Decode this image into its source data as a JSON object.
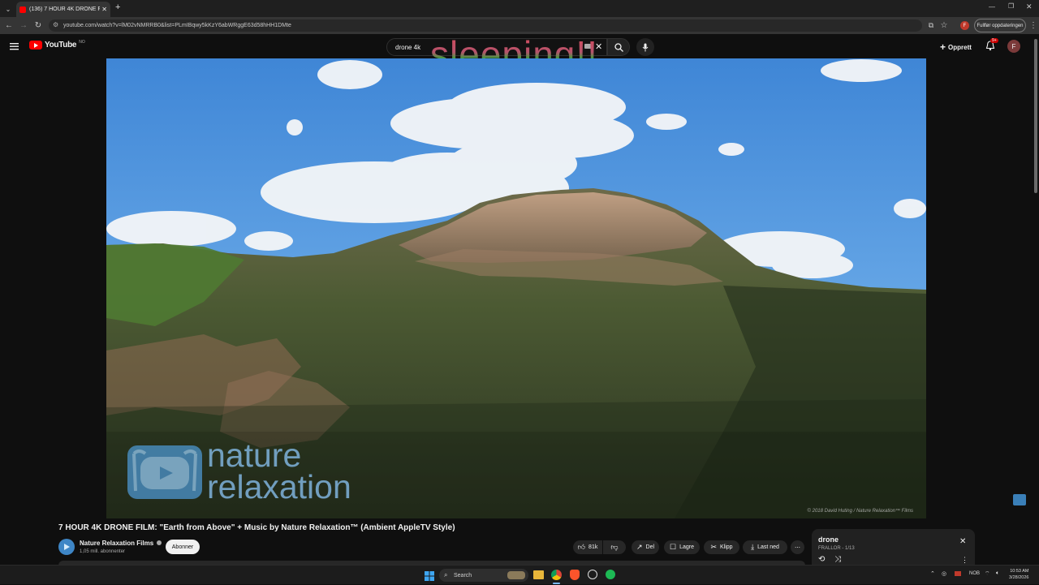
{
  "browser": {
    "tab_title": "(136) 7 HOUR 4K DRONE FILM",
    "url": "youtube.com/watch?v=lM02vNMRRB0&list=PLmIBqwy5kKzY6abWRggE63d58hHH1DMte",
    "update_button": "Fullfør oppdateringen",
    "profile_initial": "F"
  },
  "youtube": {
    "logo_text": "YouTube",
    "region": "NO",
    "search_value": "drone 4k",
    "overlay_text": "sleeping!!",
    "create_label": "Opprett",
    "notifications_badge": "9+",
    "avatar_initial": "F"
  },
  "video": {
    "watermark_line1": "nature",
    "watermark_line2": "relaxation",
    "copyright": "© 2018 David Huting / Nature Relaxation™ Films",
    "title": "7 HOUR 4K DRONE FILM: \"Earth from Above\" + Music by Nature Relaxation™ (Ambient AppleTV Style)"
  },
  "channel": {
    "name": "Nature Relaxation Films",
    "subscribers": "1,05 mill. abonnenter",
    "subscribe_label": "Abonner"
  },
  "actions": {
    "likes": "81k",
    "share": "Del",
    "save": "Lagre",
    "clip": "Klipp",
    "download": "Last ned"
  },
  "playlist": {
    "title": "drone",
    "subtitle": "FRALLOR - 1/13"
  },
  "taskbar": {
    "search_label": "Search",
    "lang": "NOB",
    "time": "10:53 AM",
    "date": "3/28/2026"
  },
  "colors": {
    "yt_red": "#ff0000",
    "overlay_red": "#d84a5a",
    "overlay_green": "#3aa03a"
  }
}
